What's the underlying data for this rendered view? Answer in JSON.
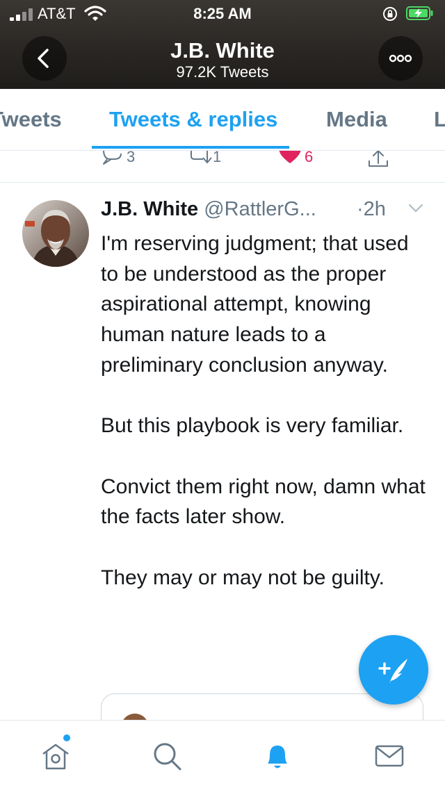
{
  "status_bar": {
    "carrier": "AT&T",
    "time": "8:25 AM"
  },
  "header": {
    "name": "J.B. White",
    "subtitle": "97.2K Tweets"
  },
  "tabs": [
    {
      "label": "Tweets",
      "visible_text": "Tweets",
      "active": false
    },
    {
      "label": "Tweets & replies",
      "active": true
    },
    {
      "label": "Media",
      "active": false
    },
    {
      "label": "Likes",
      "visible_text": "L",
      "active": false
    }
  ],
  "previous_tweet_actions": {
    "reply_count": "3",
    "retweet_count": "1",
    "like_count": "6"
  },
  "tweet": {
    "name": "J.B. White",
    "handle": "@RattlerG...",
    "time": "·2h",
    "paragraphs": [
      "I'm reserving judgment; that used to be understood as the proper aspirational attempt, knowing human nature leads to a preliminary conclusion anyway.",
      "But this playbook is very familiar.",
      "Convict them right now, damn what the facts later show.",
      "They may or may not be guilty."
    ]
  },
  "icons": {
    "back": "chevron-left-icon",
    "more": "more-horizontal-icon",
    "compose": "compose-tweet-icon",
    "nav": [
      "home-icon",
      "search-icon",
      "notifications-icon",
      "messages-icon"
    ]
  },
  "colors": {
    "accent": "#1da1f2",
    "like": "#e0245e",
    "secondary_text": "#657786",
    "battery": "#4cd964"
  }
}
